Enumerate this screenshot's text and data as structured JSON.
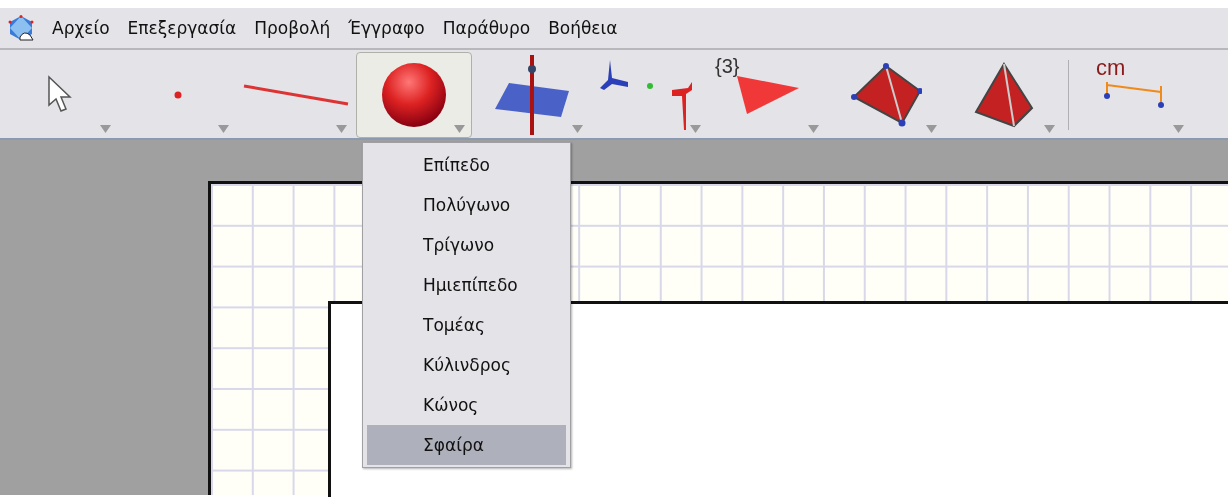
{
  "menu_bar": [
    "Αρχείο",
    "Επεξεργασία",
    "Προβολή",
    "Έγγραφο",
    "Παράθυρο",
    "Βοήθεια"
  ],
  "toolbar": [
    {
      "kind": "pointer",
      "selected": false
    },
    {
      "kind": "point",
      "selected": false
    },
    {
      "kind": "line",
      "selected": false
    },
    {
      "kind": "sphere",
      "selected": true
    },
    {
      "kind": "plane",
      "selected": false
    },
    {
      "kind": "perpendicular",
      "selected": false
    },
    {
      "kind": "polygon",
      "selected": false,
      "icon_text": "{3}"
    },
    {
      "kind": "tetrahedron",
      "selected": false
    },
    {
      "kind": "pyramid",
      "selected": false
    },
    {
      "kind": "measure",
      "selected": false,
      "icon_text": "cm"
    }
  ],
  "dropdown_menu": [
    {
      "label": "Επίπεδο",
      "selected": false
    },
    {
      "label": "Πολύγωνο",
      "selected": false
    },
    {
      "label": "Τρίγωνο",
      "selected": false
    },
    {
      "label": "Ημιεπίπεδο",
      "selected": false
    },
    {
      "label": "Τομέας",
      "selected": false
    },
    {
      "label": "Κύλινδρος",
      "selected": false
    },
    {
      "label": "Κώνος",
      "selected": false
    },
    {
      "label": "Σφαίρα",
      "selected": true
    }
  ]
}
